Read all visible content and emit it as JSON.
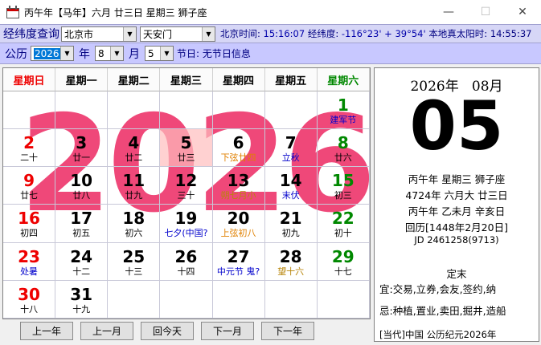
{
  "window": {
    "title": "丙午年【马年】六月 廿三日 星期三 狮子座"
  },
  "location": {
    "label": "经纬度查询",
    "city": "北京市",
    "district": "天安门",
    "time_label": "北京时间:",
    "time": "15:16:07",
    "coord_label": "经纬度:",
    "coord": "-116°23' + 39°54'",
    "solar_label": "本地真太阳时:",
    "solar_time": "14:55:37"
  },
  "date_select": {
    "label": "公历",
    "year": "2026",
    "year_unit": "年",
    "month": "8",
    "month_unit": "月",
    "day": "5",
    "festival": "节日: 无节日信息"
  },
  "calendar": {
    "watermark": "2026",
    "weekdays": [
      "星期日",
      "星期一",
      "星期二",
      "星期三",
      "星期四",
      "星期五",
      "星期六"
    ],
    "weeks": [
      [
        null,
        null,
        null,
        null,
        null,
        null,
        {
          "d": "1",
          "l": "建军节",
          "lc": "c-blue"
        }
      ],
      [
        {
          "d": "2",
          "l": "二十"
        },
        {
          "d": "3",
          "l": "廿一"
        },
        {
          "d": "4",
          "l": "廿二"
        },
        {
          "d": "5",
          "l": "廿三",
          "today": true
        },
        {
          "d": "6",
          "l": "下弦廿四",
          "lc": "c-orange"
        },
        {
          "d": "7",
          "l": "立秋",
          "lc": "c-blue"
        },
        {
          "d": "8",
          "l": "廿六"
        }
      ],
      [
        {
          "d": "9",
          "l": "廿七"
        },
        {
          "d": "10",
          "l": "廿八"
        },
        {
          "d": "11",
          "l": "廿九"
        },
        {
          "d": "12",
          "l": "三十"
        },
        {
          "d": "13",
          "l": "朔七月小",
          "lc": "c-gold"
        },
        {
          "d": "14",
          "l": "末伏",
          "lc": "c-blue"
        },
        {
          "d": "15",
          "l": "初三"
        }
      ],
      [
        {
          "d": "16",
          "l": "初四"
        },
        {
          "d": "17",
          "l": "初五"
        },
        {
          "d": "18",
          "l": "初六"
        },
        {
          "d": "19",
          "l": "七夕(中国?",
          "lc": "c-blue"
        },
        {
          "d": "20",
          "l": "上弦初八",
          "lc": "c-orange"
        },
        {
          "d": "21",
          "l": "初九"
        },
        {
          "d": "22",
          "l": "初十"
        }
      ],
      [
        {
          "d": "23",
          "l": "处暑",
          "lc": "c-blue"
        },
        {
          "d": "24",
          "l": "十二"
        },
        {
          "d": "25",
          "l": "十三"
        },
        {
          "d": "26",
          "l": "十四"
        },
        {
          "d": "27",
          "l": "中元节 鬼?",
          "lc": "c-blue"
        },
        {
          "d": "28",
          "l": "望十六",
          "lc": "c-gold"
        },
        {
          "d": "29",
          "l": "十七"
        }
      ],
      [
        {
          "d": "30",
          "l": "十八"
        },
        {
          "d": "31",
          "l": "十九"
        },
        null,
        null,
        null,
        null,
        null
      ]
    ]
  },
  "nav": {
    "prev_year": "上一年",
    "prev_month": "上一月",
    "today": "回今天",
    "next_month": "下一月",
    "next_year": "下一年"
  },
  "panel": {
    "year": "2026年",
    "month": "08月",
    "day": "05",
    "line1": "丙午年 星期三 狮子座",
    "line2": "4724年 六月大 廿三日",
    "line3": "丙午年 乙未月 辛亥日",
    "line4": "回历[1448年2月20日]",
    "line5": "JD 2461258(9713)",
    "line6": "定末",
    "yi": "宜:交易,立券,会友,签约,纳",
    "ji": "忌:种植,置业,卖田,掘井,造船",
    "footer": "[当代]中国  公历纪元2026年"
  },
  "colors": {
    "sunday": "#e00000",
    "saturday": "#008800",
    "watermark": "#ef4879",
    "today_bg": "#ffbebe",
    "header_bar": "#c8c8ff"
  }
}
